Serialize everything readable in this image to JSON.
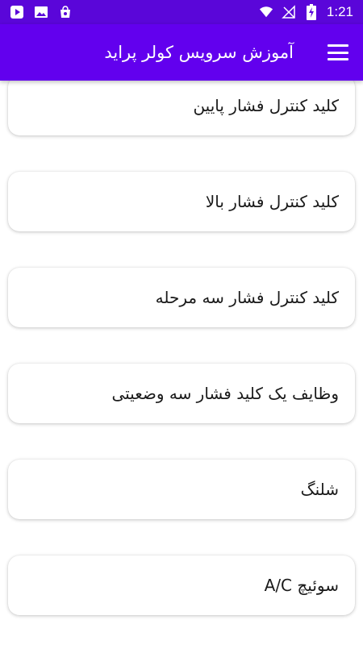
{
  "status_bar": {
    "time": "1:21",
    "left_icons": [
      "play-protect-icon",
      "image-icon",
      "shopping-bag-icon"
    ],
    "right_icons": [
      "wifi-icon",
      "no-signal-icon",
      "battery-charging-icon"
    ]
  },
  "app_bar": {
    "title": "آموزش سرویس کولر پراید",
    "menu_icon": "hamburger-menu-icon"
  },
  "list": {
    "items": [
      {
        "label": "کلید کنترل فشار پایین"
      },
      {
        "label": "کلید کنترل فشار بالا"
      },
      {
        "label": "کلید کنترل فشار سه مرحله"
      },
      {
        "label": "وظایف یک کلید فشار سه وضعیتی"
      },
      {
        "label": "شلنگ"
      },
      {
        "label": "سوئیچ A/C"
      }
    ]
  },
  "colors": {
    "status_bar": "#5a06d9",
    "app_bar": "#6200ee",
    "card_background": "#ffffff"
  }
}
